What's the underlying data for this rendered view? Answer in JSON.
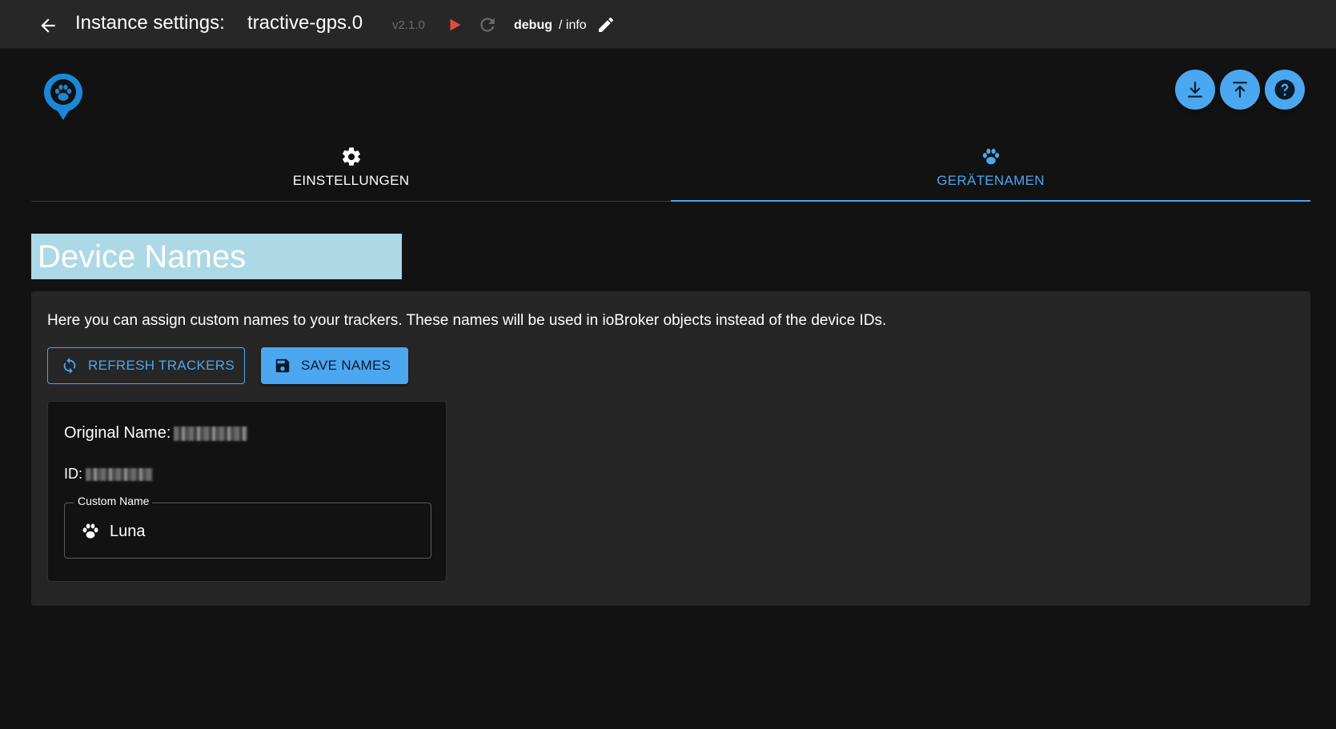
{
  "topbar": {
    "title_label": "Instance settings:",
    "title_instance": "tractive-gps.0",
    "version": "v2.1.0",
    "log_level": "debug",
    "log_separator_level": "/ info"
  },
  "tabs": [
    {
      "label": "EINSTELLUNGEN",
      "icon": "gear-icon",
      "active": false
    },
    {
      "label": "GERÄTENAMEN",
      "icon": "paw-icon",
      "active": true
    }
  ],
  "page": {
    "heading": "Device Names",
    "intro": "Here you can assign custom names to your trackers. These names will be used in ioBroker objects instead of the device IDs.",
    "refresh_label": "REFRESH TRACKERS",
    "save_label": "SAVE NAMES"
  },
  "device": {
    "original_name_label": "Original Name:",
    "id_label": "ID:",
    "custom_name_legend": "Custom Name",
    "custom_name_value": "Luna"
  },
  "colors": {
    "accent": "#4ba7f0",
    "play": "#e8473f",
    "header_box": "#add8e6",
    "background": "#121212",
    "topbar": "#272727",
    "panel": "#262626"
  }
}
